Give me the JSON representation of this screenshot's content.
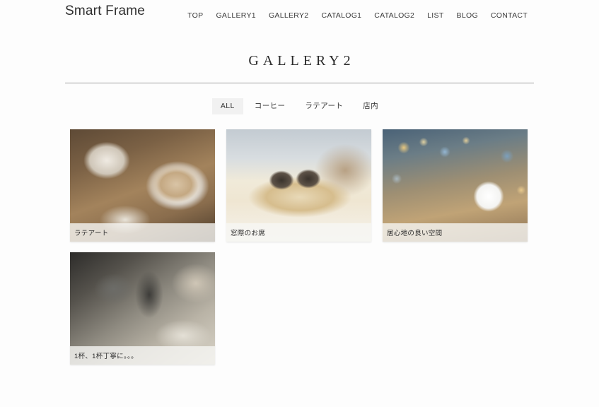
{
  "header": {
    "logo": "Smart Frame",
    "nav": [
      {
        "label": "TOP"
      },
      {
        "label": "GALLERY1"
      },
      {
        "label": "GALLERY2"
      },
      {
        "label": "CATALOG1"
      },
      {
        "label": "CATALOG2"
      },
      {
        "label": "LIST"
      },
      {
        "label": "BLOG"
      },
      {
        "label": "CONTACT"
      }
    ]
  },
  "page": {
    "title": "GALLERY2"
  },
  "filters": {
    "tabs": [
      {
        "label": "ALL",
        "active": true
      },
      {
        "label": "コーヒー",
        "active": false
      },
      {
        "label": "ラテアート",
        "active": false
      },
      {
        "label": "店内",
        "active": false
      }
    ]
  },
  "gallery": {
    "items": [
      {
        "caption": "ラテアート"
      },
      {
        "caption": "窓際のお席"
      },
      {
        "caption": "居心地の良い空間"
      },
      {
        "caption": "1杯、1杯丁寧に。。。"
      }
    ]
  },
  "colors": {
    "background": "#fdfdfd",
    "text": "#2f2f2f",
    "rule": "#9e9e9e",
    "active_tab_bg": "#f1f1f1"
  }
}
